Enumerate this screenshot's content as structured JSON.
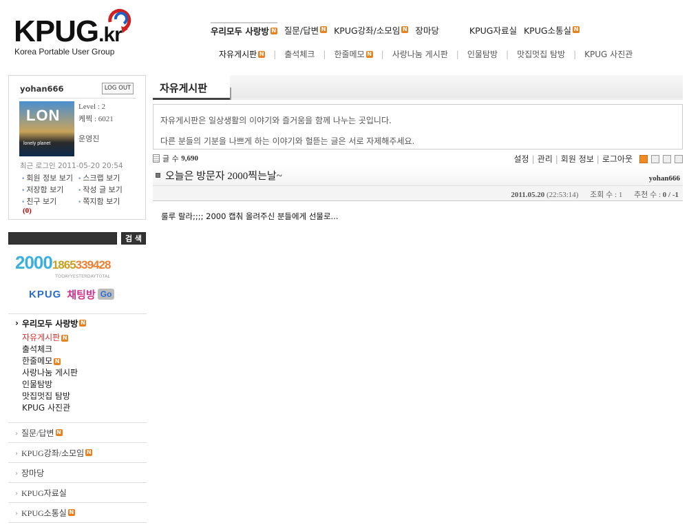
{
  "logo": {
    "brand": "KPUG",
    "brand_suffix": ".kr",
    "tagline": "Korea Portable User Group"
  },
  "topnav": {
    "primary": [
      {
        "label": "우리모두 사랑방",
        "new": true,
        "active": true
      },
      {
        "label": "질문/답변",
        "new": true
      },
      {
        "label": "KPUG강좌/소모임",
        "new": true
      },
      {
        "label": "장마당",
        "new": false
      },
      {
        "label": "KPUG자료실",
        "new": false
      },
      {
        "label": "KPUG소통실",
        "new": true
      }
    ],
    "secondary": [
      {
        "label": "자유게시판",
        "new": true,
        "active": true
      },
      {
        "label": "출석체크",
        "new": false
      },
      {
        "label": "한줄메모",
        "new": true
      },
      {
        "label": "사랑나눔 게시판",
        "new": false
      },
      {
        "label": "인물탐방",
        "new": false
      },
      {
        "label": "맛집멋집 탐방",
        "new": false
      },
      {
        "label": "KPUG 사진관",
        "new": false
      }
    ]
  },
  "login": {
    "username": "yohan666",
    "logout_label": "LOG OUT",
    "avatar_text": "LON",
    "avatar_sub": "lonely planet",
    "level": "Level : 2",
    "points": "케찍 : 6021",
    "role": "운영진",
    "last_login": "최근 로그인 2011-05-20 20:54",
    "links": [
      "회원 정보 보기",
      "스크랩 보기",
      "저장함 보기",
      "작성 글 보기",
      "친구 보기",
      "쪽지함 보기"
    ],
    "message_count": "(0)"
  },
  "search": {
    "button_label": "검 색",
    "value": ""
  },
  "counter": {
    "today": "2000",
    "yesterday": "1865",
    "total": "339428",
    "label": "TODAYYESTERDAYTOTAL"
  },
  "chat": {
    "brand": "KPUG",
    "label": "채팅방",
    "go": "Go"
  },
  "sidemenu": {
    "open_section": {
      "label": "우리모두 사랑방",
      "new": true
    },
    "subs": [
      {
        "label": "자유게시판",
        "new": true,
        "selected": true
      },
      {
        "label": "출석체크",
        "new": false
      },
      {
        "label": "한줄메모",
        "new": true
      },
      {
        "label": "사랑나눔 게시판",
        "new": false
      },
      {
        "label": "인물탐방",
        "new": false
      },
      {
        "label": "맛집멋집 탐방",
        "new": false
      },
      {
        "label": "KPUG 사진관",
        "new": false
      }
    ],
    "sections": [
      {
        "label": "질문/답변",
        "new": true
      },
      {
        "label": "KPUG강좌/소모임",
        "new": true
      },
      {
        "label": "장마당",
        "new": false
      },
      {
        "label": "KPUG자료실",
        "new": false
      },
      {
        "label": "KPUG소통실",
        "new": true
      }
    ]
  },
  "board": {
    "title": "자유게시판",
    "desc1": "자유게시판은 일상생활의 이야기와 즐거움을 함께 나누는 곳입니다.",
    "desc2": "다른 분들의 기분을 나쁘게 하는 이야기와 헐뜯는 글은 서로 자제해주세요.",
    "count_label": "글 수",
    "count_value": "9,690",
    "menu": [
      "설정",
      "관리",
      "회원 정보",
      "로그아웃"
    ]
  },
  "post": {
    "title": "오늘은 방문자 2000찍는날~",
    "author": "yohan666",
    "date": "2011.05.20",
    "time": "(22:53:14)",
    "views_label": "조회 수 :",
    "views": "1",
    "votes_label": "추천 수 :",
    "votes": "0 / -1",
    "body": "룰루 랄라;;;; 2000 캡춰 올려주신 분들에게 선물로..."
  },
  "new_badge": "N"
}
